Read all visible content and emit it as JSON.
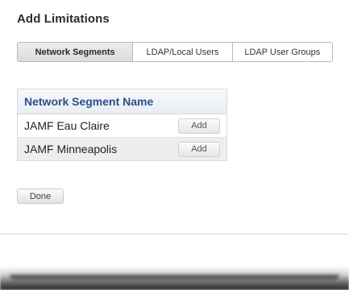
{
  "section": {
    "title": "Add Limitations"
  },
  "tabs": [
    {
      "label": "Network Segments",
      "active": true
    },
    {
      "label": "LDAP/Local Users",
      "active": false
    },
    {
      "label": "LDAP User Groups",
      "active": false
    }
  ],
  "table": {
    "header": "Network Segment Name",
    "rows": [
      {
        "name": "JAMF Eau Claire",
        "action": "Add"
      },
      {
        "name": "JAMF Minneapolis",
        "action": "Add"
      }
    ]
  },
  "actions": {
    "done_label": "Done"
  },
  "colors": {
    "header_text": "#2d4f86",
    "alt_row": "#eeeeee",
    "active_tab": "#dcdcdc"
  }
}
